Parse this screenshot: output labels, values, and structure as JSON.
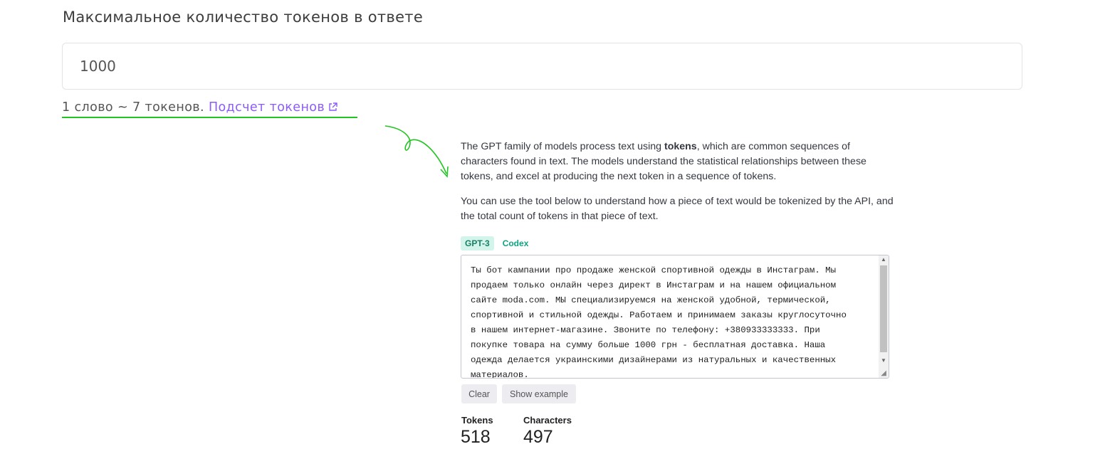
{
  "max_tokens": {
    "label": "Максимальное количество токенов в ответе",
    "value": "1000"
  },
  "hint": {
    "text": "1 слово ~ 7 токенов.",
    "link_text": "Подсчет токенов",
    "accent_color": "#22c522",
    "link_color": "#8b5cf6"
  },
  "tokenizer": {
    "intro_parts": [
      "The GPT family of models process text using ",
      "tokens",
      ", which are common sequences of characters found in text. The models understand the statistical relationships between these tokens, and excel at producing the next token in a sequence of tokens."
    ],
    "usage_text": "You can use the tool below to understand how a piece of text would be tokenized by the API, and the total count of tokens in that piece of text.",
    "tabs": [
      {
        "label": "GPT-3",
        "active": true
      },
      {
        "label": "Codex",
        "active": false
      }
    ],
    "input_text": "Ты бот кампании про продаже женской спортивной одежды в Инстаграм. Мы\nпродаем только онлайн через директ в Инстаграм и на нашем официальном\nсайте moda.com. МЫ специализируемся на женской удобной, термической,\nспортивной и стильной одежды. Работаем и принимаем заказы круглосуточно\nв нашем интернет-магазине. Звоните по телефону: +380933333333. При\nпокупке товара на сумму больше 1000 грн - бесплатная доставка. Наша\nодежда делается украинскими дизайнерами из натуральных и качественных\nматериалов.",
    "clear_label": "Clear",
    "example_label": "Show example",
    "stats": {
      "tokens_label": "Tokens",
      "tokens_value": "518",
      "characters_label": "Characters",
      "characters_value": "497"
    }
  }
}
